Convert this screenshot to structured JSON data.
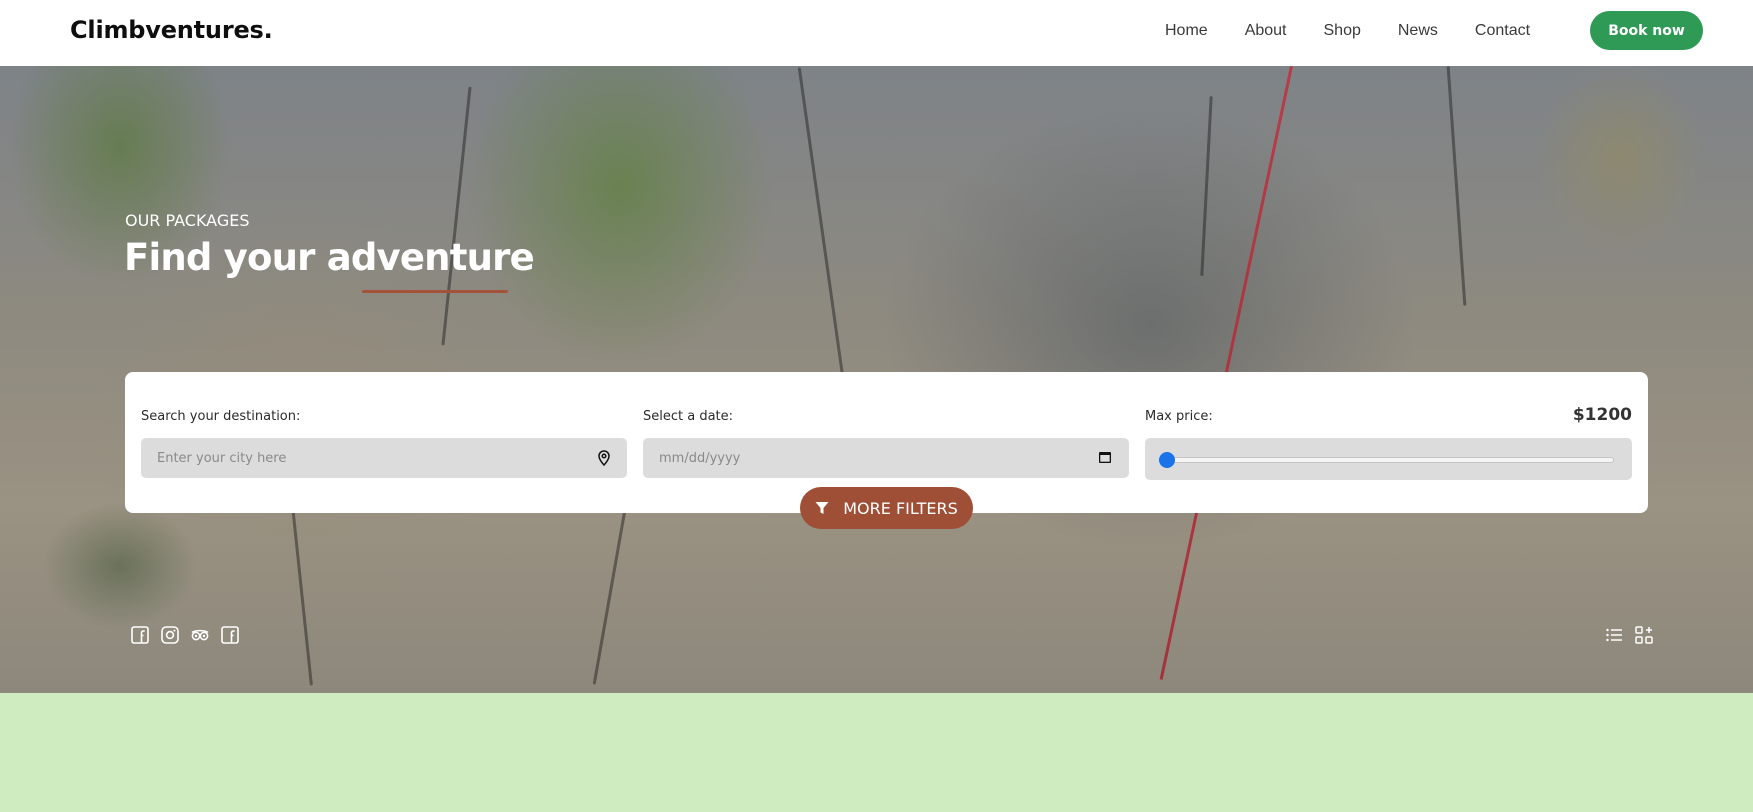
{
  "brand": {
    "name": "Climbventures."
  },
  "nav": {
    "links": [
      "Home",
      "About",
      "Shop",
      "News",
      "Contact"
    ],
    "cta": "Book now"
  },
  "hero": {
    "kicker": "OUR PACKAGES",
    "title_main": "Find your ",
    "title_highlight": "adventure"
  },
  "search": {
    "destination_label": "Search your destination:",
    "destination_placeholder": "Enter your city here",
    "destination_icon": "location-pin-icon",
    "date_label": "Select a date:",
    "date_placeholder": "mm/dd/yyyy",
    "date_icon": "calendar-icon",
    "price_label": "Max price:",
    "price_value": "$1200",
    "price_slider_fraction": 0.0
  },
  "filters": {
    "label": "MORE FILTERS",
    "icon": "filter-funnel-icon"
  },
  "social_icons": [
    "facebook-icon",
    "instagram-icon",
    "tripadvisor-icon",
    "facebook-icon"
  ],
  "view_icons": [
    "list-view-icon",
    "grid-view-icon"
  ],
  "colors": {
    "accent_green": "#2e9a55",
    "accent_rust": "#a04f37",
    "bottom_band": "#ceecc0",
    "slider_thumb": "#1a73e8"
  }
}
